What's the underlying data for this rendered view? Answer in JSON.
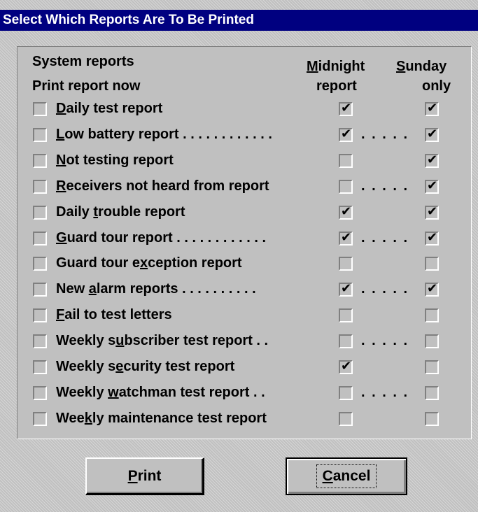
{
  "window": {
    "title": "Select Which Reports Are To Be Printed"
  },
  "headers": {
    "system_reports": "System reports",
    "print_now": "Print report now",
    "midnight_1": "Midnight",
    "midnight_2": "report",
    "sunday_1": "Sunday",
    "sunday_2": "only"
  },
  "check_glyph": "✔",
  "reports": [
    {
      "pre": "",
      "key": "D",
      "post": "aily test report",
      "dots": "",
      "mid_dots": "",
      "now": false,
      "midnight": true,
      "sunday": true
    },
    {
      "pre": "",
      "key": "L",
      "post": "ow battery report",
      "dots": ". . . . . . . . . . . .",
      "mid_dots": ". . . . .",
      "now": false,
      "midnight": true,
      "sunday": true
    },
    {
      "pre": "",
      "key": "N",
      "post": "ot testing report",
      "dots": "",
      "mid_dots": "",
      "now": false,
      "midnight": false,
      "sunday": true
    },
    {
      "pre": "",
      "key": "R",
      "post": "eceivers not heard from report",
      "dots": "",
      "mid_dots": ". . . . .",
      "now": false,
      "midnight": false,
      "sunday": true
    },
    {
      "pre": "Daily ",
      "key": "t",
      "post": "rouble report",
      "dots": "",
      "mid_dots": "",
      "now": false,
      "midnight": true,
      "sunday": true
    },
    {
      "pre": "",
      "key": "G",
      "post": "uard tour report",
      "dots": ". . . . . . . . . . . .",
      "mid_dots": ". . . . .",
      "now": false,
      "midnight": true,
      "sunday": true
    },
    {
      "pre": "Guard tour e",
      "key": "x",
      "post": "ception report",
      "dots": "",
      "mid_dots": "",
      "now": false,
      "midnight": false,
      "sunday": false
    },
    {
      "pre": "New ",
      "key": "a",
      "post": "larm reports",
      "dots": ". . . . . . . . . .",
      "mid_dots": ". . . . .",
      "now": false,
      "midnight": true,
      "sunday": true
    },
    {
      "pre": "",
      "key": "F",
      "post": "ail to test letters",
      "dots": "",
      "mid_dots": "",
      "now": false,
      "midnight": false,
      "sunday": false
    },
    {
      "pre": "Weekly s",
      "key": "u",
      "post": "bscriber test report",
      "dots": ". .",
      "mid_dots": ". . . . .",
      "now": false,
      "midnight": false,
      "sunday": false
    },
    {
      "pre": "Weekly s",
      "key": "e",
      "post": "curity test report",
      "dots": "",
      "mid_dots": "",
      "now": false,
      "midnight": true,
      "sunday": false
    },
    {
      "pre": "Weekly ",
      "key": "w",
      "post": "atchman test report",
      "dots": ". .",
      "mid_dots": ". . . . .",
      "now": false,
      "midnight": false,
      "sunday": false
    },
    {
      "pre": "Wee",
      "key": "k",
      "post": "ly maintenance test report",
      "dots": "",
      "mid_dots": "",
      "now": false,
      "midnight": false,
      "sunday": false
    }
  ],
  "buttons": {
    "print_key": "P",
    "print_rest": "rint",
    "cancel_key": "C",
    "cancel_rest": "ancel"
  }
}
